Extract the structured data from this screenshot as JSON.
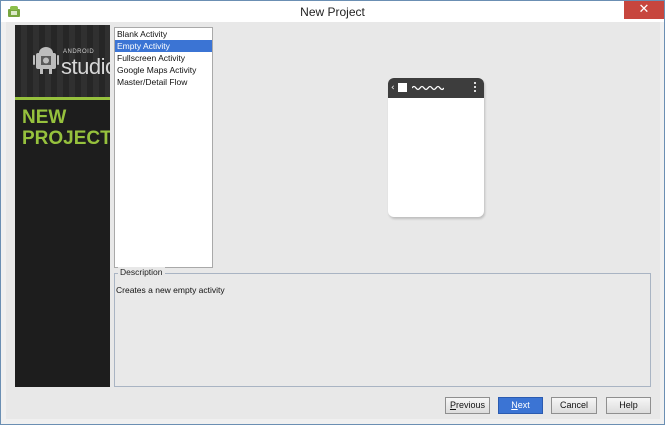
{
  "window": {
    "title": "New Project",
    "close_glyph": "✕"
  },
  "banner": {
    "logo_small": "ANDROID",
    "logo_large": "studio",
    "heading_line1": "NEW",
    "heading_line2": "PROJECT",
    "accent_color": "#96c13d"
  },
  "activities": {
    "items": [
      "Blank Activity",
      "Empty Activity",
      "Fullscreen Activity",
      "Google Maps Activity",
      "Master/Detail Flow"
    ],
    "selected": "Empty Activity"
  },
  "description": {
    "legend": "Description",
    "text": "Creates a new empty activity"
  },
  "buttons": {
    "previous_mnemonic": "P",
    "previous_rest": "revious",
    "next_mnemonic": "N",
    "next_rest": "ext",
    "cancel": "Cancel",
    "help": "Help"
  },
  "icons": {
    "app": "android-studio-icon",
    "close": "close-icon",
    "preview_back": "back-arrow-icon",
    "preview_overflow": "overflow-menu-icon"
  },
  "colors": {
    "selection": "#3b74d4",
    "close_button": "#c7463e"
  }
}
